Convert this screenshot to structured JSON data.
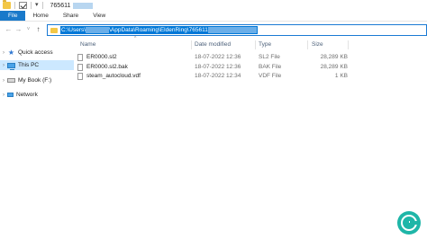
{
  "window": {
    "title_prefix": "765611"
  },
  "ribbon": {
    "tabs": [
      "File",
      "Home",
      "Share",
      "View"
    ]
  },
  "address": {
    "seg_drive": "C:\\Users\\",
    "seg_path": "\\AppData\\Roaming\\EldenRing\\765611"
  },
  "sidebar": {
    "items": [
      {
        "label": "Quick access",
        "icon": "star-icon"
      },
      {
        "label": "This PC",
        "icon": "computer-icon"
      },
      {
        "label": "My Book (F:)",
        "icon": "drive-icon"
      },
      {
        "label": "Network",
        "icon": "network-icon"
      }
    ]
  },
  "file_list": {
    "columns": [
      "Name",
      "Date modified",
      "Type",
      "Size"
    ],
    "rows": [
      {
        "name": "ER0000.sl2",
        "date": "18-07-2022 12:36",
        "type": "SL2 File",
        "size": "28,289 KB"
      },
      {
        "name": "ER0000.sl2.bak",
        "date": "18-07-2022 12:36",
        "type": "BAK File",
        "size": "28,289 KB"
      },
      {
        "name": "steam_autocloud.vdf",
        "date": "18-07-2022 12:34",
        "type": "VDF File",
        "size": "1 KB"
      }
    ]
  },
  "colors": {
    "accent": "#0078d7",
    "file_tab": "#1979ca",
    "selection": "#cce8ff",
    "logo": "#1fb6a8"
  }
}
